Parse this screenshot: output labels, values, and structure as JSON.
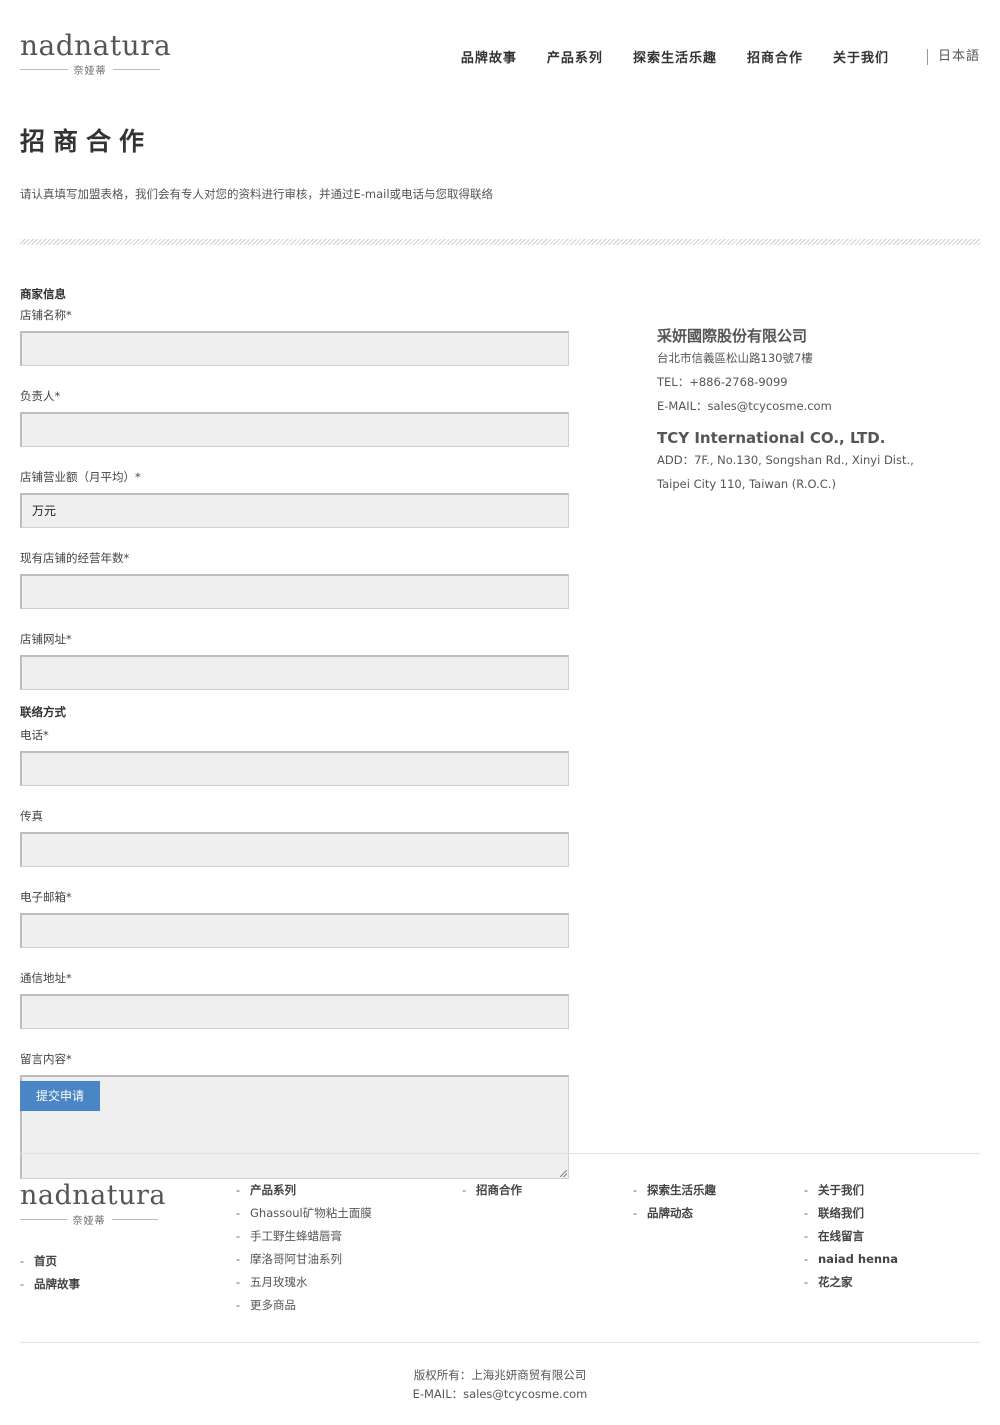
{
  "brand": {
    "name": "nadnatura",
    "sub": "奈娅蒂"
  },
  "nav": {
    "items": [
      "品牌故事",
      "产品系列",
      "探索生活乐趣",
      "招商合作",
      "关于我们"
    ],
    "lang": "日本語"
  },
  "page": {
    "title": "招商合作",
    "intro": "请认真填写加盟表格，我们会有专人对您的资料进行审核，并通过E-mail或电话与您取得联络"
  },
  "form": {
    "section_merchant": "商家信息",
    "section_contact": "联络方式",
    "fields": [
      {
        "label": "店铺名称",
        "value": ""
      },
      {
        "label": "负责人",
        "value": ""
      },
      {
        "label": "店铺营业额（月平均）",
        "value": "万元"
      },
      {
        "label": "现有店铺的经营年数",
        "value": ""
      },
      {
        "label": "店铺网址",
        "value": ""
      },
      {
        "label": "电话",
        "value": ""
      },
      {
        "label": "传真",
        "value": ""
      },
      {
        "label": "电子邮箱",
        "value": ""
      },
      {
        "label": "通信地址",
        "value": ""
      },
      {
        "label": "留言内容",
        "value": ""
      }
    ],
    "required_mark": "*",
    "submit_label": "提交申请"
  },
  "company": {
    "name_zh": "采妍國際股份有限公司",
    "addr_zh": "台北市信義區松山路130號7樓",
    "tel": "TEL：+886-2768-9099",
    "email": "E-MAIL：sales@tcycosme.com",
    "name_en": "TCY International CO., LTD.",
    "addr_en_1": "ADD：7F., No.130, Songshan Rd., Xinyi Dist.,",
    "addr_en_2": "Taipei City 110, Taiwan (R.O.C.)"
  },
  "footer": {
    "col0": [
      "首页",
      "品牌故事"
    ],
    "col1": [
      "产品系列",
      "Ghassoul矿物粘土面膜",
      "手工野生蜂蜡唇膏",
      "摩洛哥阿甘油系列",
      "五月玫瑰水",
      "更多商品"
    ],
    "col2": [
      "招商合作"
    ],
    "col3": [
      "探索生活乐趣",
      "品牌动态"
    ],
    "col4": [
      "关于我们",
      "联络我们",
      "在线留言",
      "naiad henna",
      "花之家"
    ],
    "dash": "-",
    "copyright": "版权所有：上海兆妍商贸有限公司",
    "email": "E-MAIL：sales@tcycosme.com"
  }
}
